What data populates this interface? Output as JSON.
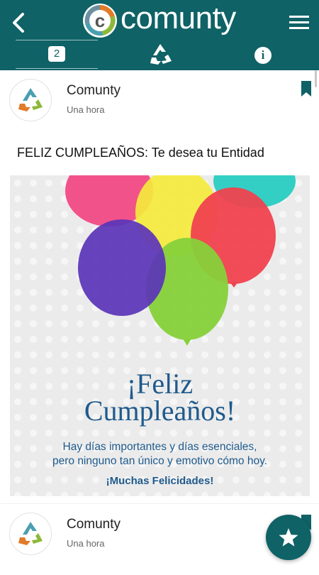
{
  "app": {
    "name": "comunty"
  },
  "header": {
    "back_icon": "chevron-left-icon",
    "menu_icon": "hamburger-icon",
    "tabs": [
      {
        "label": "2",
        "icon": "notifications-badge"
      },
      {
        "label": "",
        "icon": "recycle-icon"
      },
      {
        "label": "i",
        "icon": "info-icon"
      }
    ]
  },
  "posts": [
    {
      "author": "Comunty",
      "time": "Una hora",
      "title": "FELIZ CUMPLEAÑOS: Te desea tu Entidad",
      "image": {
        "line1": "¡Feliz",
        "line2": "Cumpleaños!",
        "body1": "Hay días importantes y días esenciales,",
        "body2": "pero ninguno tan único y emotivo cómo hoy.",
        "closing": "¡Muchas Felicidades!"
      }
    },
    {
      "author": "Comunty",
      "time": "Una hora"
    }
  ],
  "colors": {
    "primary": "#0f6266",
    "text_blue": "#1f5a8c"
  }
}
